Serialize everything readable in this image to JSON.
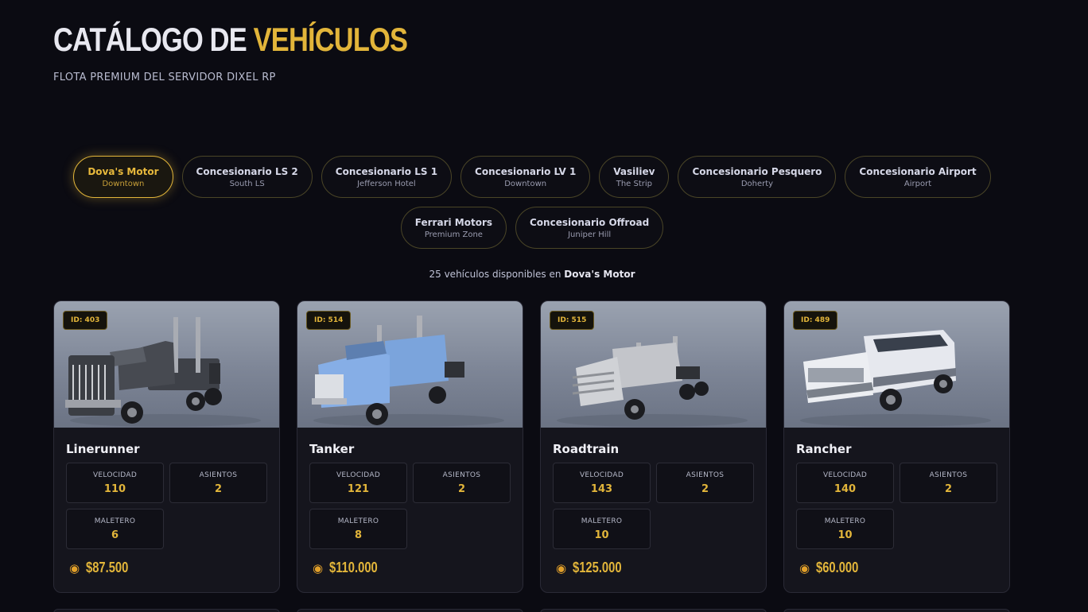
{
  "header": {
    "title_part1": "CATÁLOGO DE",
    "title_part2": "VEHÍCULOS",
    "subtitle": "FLOTA PREMIUM DEL SERVIDOR DIXEL RP"
  },
  "dealers_row1": [
    {
      "name": "Dova's Motor",
      "location": "Downtown",
      "active": true
    },
    {
      "name": "Concesionario LS 2",
      "location": "South LS"
    },
    {
      "name": "Concesionario LS 1",
      "location": "Jefferson Hotel"
    },
    {
      "name": "Concesionario LV 1",
      "location": "Downtown"
    },
    {
      "name": "Vasiliev",
      "location": "The Strip"
    },
    {
      "name": "Concesionario Pesquero",
      "location": "Doherty"
    },
    {
      "name": "Concesionario Airport",
      "location": "Airport"
    }
  ],
  "dealers_row2": [
    {
      "name": "Ferrari Motors",
      "location": "Premium Zone"
    },
    {
      "name": "Concesionario Offroad",
      "location": "Juniper Hill"
    }
  ],
  "availability": {
    "count_text": "25 vehículos disponibles en",
    "dealer": "Dova's Motor"
  },
  "labels": {
    "speed": "VELOCIDAD",
    "seats": "ASIENTOS",
    "trunk": "MALETERO"
  },
  "vehicles": [
    {
      "id": "ID: 403",
      "name": "Linerunner",
      "speed": "110",
      "seats": "2",
      "trunk": "6",
      "price": "$87.500",
      "color": "#4a4d55"
    },
    {
      "id": "ID: 514",
      "name": "Tanker",
      "speed": "121",
      "seats": "2",
      "trunk": "8",
      "price": "$110.000",
      "color": "#7ea6e0"
    },
    {
      "id": "ID: 515",
      "name": "Roadtrain",
      "speed": "143",
      "seats": "2",
      "trunk": "10",
      "price": "$125.000",
      "color": "#c8cacf"
    },
    {
      "id": "ID: 489",
      "name": "Rancher",
      "speed": "140",
      "seats": "2",
      "trunk": "10",
      "price": "$60.000",
      "color": "#e4e6ec"
    }
  ],
  "colors": {
    "accent": "#e2b53a",
    "background": "#0b0b12",
    "card": "#15151d"
  },
  "icons": {
    "price": "money-bag-icon"
  }
}
